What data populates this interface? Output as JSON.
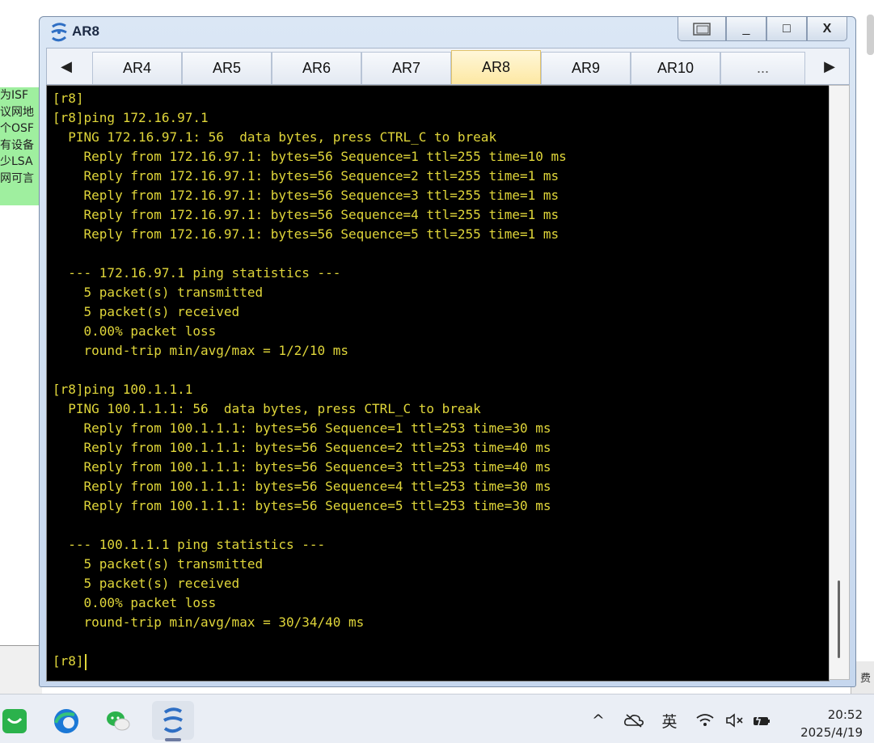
{
  "background": {
    "note_lines": [
      "为ISF",
      "议网地",
      "个OSF",
      "有设备",
      "少LSA",
      "网可言"
    ],
    "right_strip_text": "费"
  },
  "window": {
    "title": "AR8",
    "controls": {
      "restore_icon": "restore-icon",
      "minimize_label": "_",
      "maximize_label": "□",
      "close_label": "X"
    }
  },
  "tabs": {
    "prev_arrow": "◀",
    "next_arrow": "▶",
    "items": [
      {
        "label": "AR4"
      },
      {
        "label": "AR5"
      },
      {
        "label": "AR6"
      },
      {
        "label": "AR7"
      },
      {
        "label": "AR8",
        "active": true
      },
      {
        "label": "AR9"
      },
      {
        "label": "AR10"
      },
      {
        "label": "..."
      }
    ]
  },
  "terminal": {
    "text_color": "#e0d63a",
    "background": "#000000",
    "lines": [
      "[r8]",
      "[r8]ping 172.16.97.1",
      "  PING 172.16.97.1: 56  data bytes, press CTRL_C to break",
      "    Reply from 172.16.97.1: bytes=56 Sequence=1 ttl=255 time=10 ms",
      "    Reply from 172.16.97.1: bytes=56 Sequence=2 ttl=255 time=1 ms",
      "    Reply from 172.16.97.1: bytes=56 Sequence=3 ttl=255 time=1 ms",
      "    Reply from 172.16.97.1: bytes=56 Sequence=4 ttl=255 time=1 ms",
      "    Reply from 172.16.97.1: bytes=56 Sequence=5 ttl=255 time=1 ms",
      "",
      "  --- 172.16.97.1 ping statistics ---",
      "    5 packet(s) transmitted",
      "    5 packet(s) received",
      "    0.00% packet loss",
      "    round-trip min/avg/max = 1/2/10 ms",
      "",
      "[r8]ping 100.1.1.1",
      "  PING 100.1.1.1: 56  data bytes, press CTRL_C to break",
      "    Reply from 100.1.1.1: bytes=56 Sequence=1 ttl=253 time=30 ms",
      "    Reply from 100.1.1.1: bytes=56 Sequence=2 ttl=253 time=40 ms",
      "    Reply from 100.1.1.1: bytes=56 Sequence=3 ttl=253 time=40 ms",
      "    Reply from 100.1.1.1: bytes=56 Sequence=4 ttl=253 time=30 ms",
      "    Reply from 100.1.1.1: bytes=56 Sequence=5 ttl=253 time=30 ms",
      "",
      "  --- 100.1.1.1 ping statistics ---",
      "    5 packet(s) transmitted",
      "    5 packet(s) received",
      "    0.00% packet loss",
      "    round-trip min/avg/max = 30/34/40 ms",
      "",
      "[r8]"
    ]
  },
  "taskbar": {
    "apps": [
      "wechat-work-icon",
      "edge-icon",
      "wechat-icon",
      "ensp-icon"
    ],
    "tray": {
      "chevron": "^",
      "ime_label": "英"
    },
    "clock": {
      "time": "20:52",
      "date": "2025/4/19"
    }
  }
}
